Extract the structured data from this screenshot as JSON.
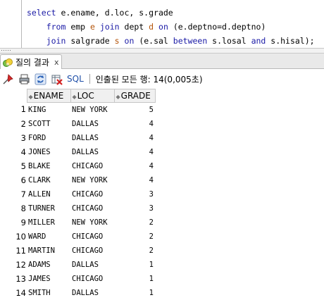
{
  "editor": {
    "line1": {
      "k1": "select",
      "t1": " e.ename, d.loc, s.grade"
    },
    "line2": {
      "k1": "from",
      "t1": " emp ",
      "a1": "e",
      "t2": " ",
      "k2": "join",
      "t3": " dept ",
      "a2": "d",
      "t4": " ",
      "k3": "on",
      "t5": " (e.deptno=d.deptno)"
    },
    "line3": {
      "k1": "join",
      "t1": " salgrade ",
      "a1": "s",
      "t2": " ",
      "k2": "on",
      "t3": " (e.sal ",
      "k3": "between",
      "t4": " s.losal ",
      "k4": "and",
      "t5": " s.hisal);"
    }
  },
  "tab": {
    "label": "질의 결과",
    "close": "x"
  },
  "toolbar": {
    "sql_label": "SQL",
    "status": "인출된 모든 행: 14(0,005초)"
  },
  "grid": {
    "columns": [
      "ENAME",
      "LOC",
      "GRADE"
    ],
    "rows": [
      {
        "n": "1",
        "ename": "KING",
        "loc": "NEW YORK",
        "grade": "5"
      },
      {
        "n": "2",
        "ename": "SCOTT",
        "loc": "DALLAS",
        "grade": "4"
      },
      {
        "n": "3",
        "ename": "FORD",
        "loc": "DALLAS",
        "grade": "4"
      },
      {
        "n": "4",
        "ename": "JONES",
        "loc": "DALLAS",
        "grade": "4"
      },
      {
        "n": "5",
        "ename": "BLAKE",
        "loc": "CHICAGO",
        "grade": "4"
      },
      {
        "n": "6",
        "ename": "CLARK",
        "loc": "NEW YORK",
        "grade": "4"
      },
      {
        "n": "7",
        "ename": "ALLEN",
        "loc": "CHICAGO",
        "grade": "3"
      },
      {
        "n": "8",
        "ename": "TURNER",
        "loc": "CHICAGO",
        "grade": "3"
      },
      {
        "n": "9",
        "ename": "MILLER",
        "loc": "NEW YORK",
        "grade": "2"
      },
      {
        "n": "10",
        "ename": "WARD",
        "loc": "CHICAGO",
        "grade": "2"
      },
      {
        "n": "11",
        "ename": "MARTIN",
        "loc": "CHICAGO",
        "grade": "2"
      },
      {
        "n": "12",
        "ename": "ADAMS",
        "loc": "DALLAS",
        "grade": "1"
      },
      {
        "n": "13",
        "ename": "JAMES",
        "loc": "CHICAGO",
        "grade": "1"
      },
      {
        "n": "14",
        "ename": "SMITH",
        "loc": "DALLAS",
        "grade": "1"
      }
    ]
  }
}
